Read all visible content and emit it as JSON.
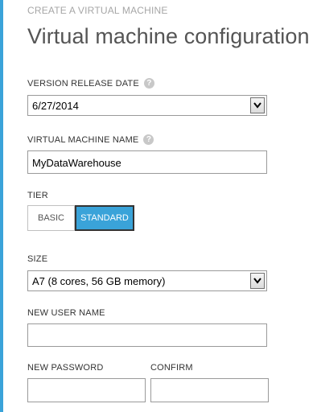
{
  "header": {
    "wizard_step": "CREATE A VIRTUAL MACHINE",
    "title": "Virtual machine configuration"
  },
  "form": {
    "version_release_date": {
      "label": "VERSION RELEASE DATE",
      "value": "6/27/2014",
      "help_icon": "question-mark-icon"
    },
    "vm_name": {
      "label": "VIRTUAL MACHINE NAME",
      "value": "MyDataWarehouse",
      "help_icon": "question-mark-icon"
    },
    "tier": {
      "label": "TIER",
      "options": [
        "BASIC",
        "STANDARD"
      ],
      "selected": "STANDARD"
    },
    "size": {
      "label": "SIZE",
      "value": "A7 (8 cores, 56 GB memory)"
    },
    "new_user_name": {
      "label": "NEW USER NAME",
      "value": ""
    },
    "new_password": {
      "label": "NEW PASSWORD",
      "value": ""
    },
    "confirm": {
      "label": "CONFIRM",
      "value": ""
    }
  },
  "colors": {
    "accent": "#3aa3d9",
    "title_text": "#555555",
    "muted_text": "#a6a6a6"
  }
}
